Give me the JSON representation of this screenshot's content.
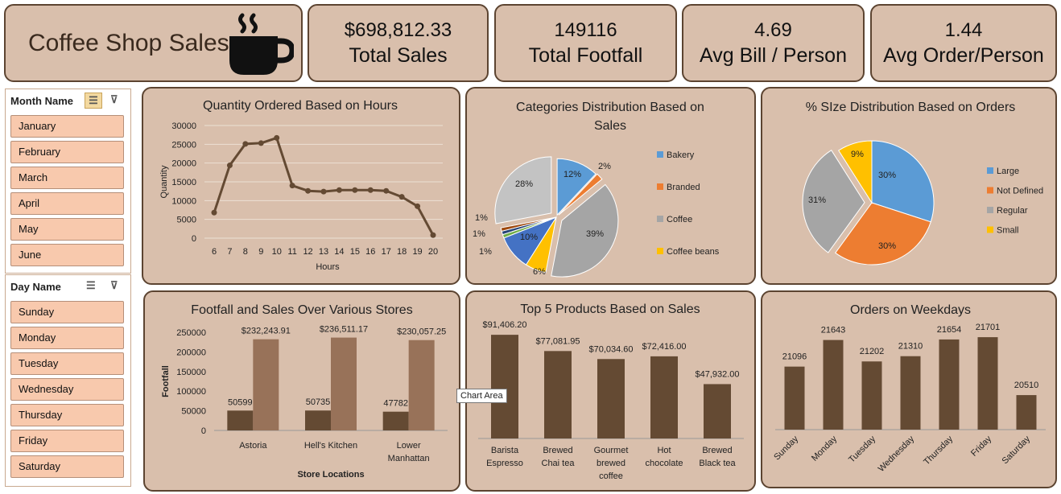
{
  "header": {
    "title": "Coffee Shop Sales",
    "icon": "coffee-cup-icon"
  },
  "kpis": [
    {
      "value": "$698,812.33",
      "label": "Total Sales"
    },
    {
      "value": "149116",
      "label": "Total Footfall"
    },
    {
      "value": "4.69",
      "label": "Avg Bill / Person"
    },
    {
      "value": "1.44",
      "label": "Avg Order/Person"
    }
  ],
  "slicers": {
    "month": {
      "title": "Month Name",
      "items": [
        "January",
        "February",
        "March",
        "April",
        "May",
        "June"
      ]
    },
    "day": {
      "title": "Day Name",
      "items": [
        "Sunday",
        "Monday",
        "Tuesday",
        "Wednesday",
        "Thursday",
        "Friday",
        "Saturday"
      ]
    }
  },
  "tooltip": "Chart Area",
  "colors": {
    "card": "#d9bfac",
    "border": "#5c4431",
    "bar_dark": "#644a33",
    "bar_light": "#987259",
    "slicer_item": "#f8c9ad"
  },
  "chart_data": [
    {
      "type": "line",
      "title": "Quantity Ordered Based on Hours",
      "xlabel": "Hours",
      "ylabel": "Quantity",
      "x": [
        6,
        7,
        8,
        9,
        10,
        11,
        12,
        13,
        14,
        15,
        16,
        17,
        18,
        19,
        20
      ],
      "values": [
        6800,
        19400,
        25100,
        25300,
        26700,
        14000,
        12600,
        12400,
        12800,
        12800,
        12800,
        12600,
        11000,
        8500,
        800
      ],
      "yticks": [
        0,
        5000,
        10000,
        15000,
        20000,
        25000,
        30000
      ],
      "ylim": [
        0,
        30000
      ],
      "grid": true
    },
    {
      "type": "pie",
      "title": "Categories Distribution Based on Sales",
      "slices": [
        {
          "name": "Bakery",
          "value": 12,
          "label": "12%",
          "color": "#5b9bd5"
        },
        {
          "name": "Branded",
          "value": 2,
          "label": "2%",
          "color": "#ed7d31"
        },
        {
          "name": "Coffee",
          "value": 39,
          "label": "39%",
          "color": "#a5a5a5"
        },
        {
          "name": "Coffee beans",
          "value": 6,
          "label": "6%",
          "color": "#ffc000"
        },
        {
          "name": "",
          "value": 10,
          "label": "10%",
          "color": "#4472c4"
        },
        {
          "name": "",
          "value": 1,
          "label": "1%",
          "color": "#70ad47"
        },
        {
          "name": "",
          "value": 1,
          "label": "1%",
          "color": "#264478"
        },
        {
          "name": "",
          "value": 1,
          "label": "1%",
          "color": "#9e480e"
        },
        {
          "name": "",
          "value": 28,
          "label": "28%",
          "color": "#c3c3c3"
        }
      ],
      "legend": [
        "Bakery",
        "Branded",
        "Coffee",
        "Coffee beans"
      ],
      "legend_placement": "right"
    },
    {
      "type": "pie",
      "title": "% SIze Distribution Based on Orders",
      "slices": [
        {
          "name": "Large",
          "value": 30,
          "label": "30%",
          "color": "#5b9bd5"
        },
        {
          "name": "Not Defined",
          "value": 30,
          "label": "30%",
          "color": "#ed7d31"
        },
        {
          "name": "Regular",
          "value": 31,
          "label": "31%",
          "color": "#a5a5a5"
        },
        {
          "name": "Small",
          "value": 9,
          "label": "9%",
          "color": "#ffc000"
        }
      ],
      "legend": [
        "Large",
        "Not Defined",
        "Regular",
        "Small"
      ],
      "legend_placement": "right"
    },
    {
      "type": "bar",
      "title": "Footfall and Sales Over Various Stores",
      "xlabel": "Store Locations",
      "ylabel": "Footfall",
      "categories": [
        [
          "Astoria"
        ],
        [
          "Hell's Kitchen"
        ],
        [
          "Lower",
          "Manhattan"
        ]
      ],
      "series": [
        {
          "values": [
            50599,
            50735,
            47782
          ],
          "labels": [
            "50599",
            "50735",
            "47782"
          ]
        },
        {
          "values": [
            232243.91,
            236511.17,
            230057.25
          ],
          "labels": [
            "$232,243.91",
            "$236,511.17",
            "$230,057.25"
          ]
        }
      ],
      "yticks": [
        0,
        50000,
        100000,
        150000,
        200000,
        250000
      ],
      "ylim": [
        0,
        250000
      ]
    },
    {
      "type": "bar",
      "title": "Top 5 Products Based on Sales",
      "categories": [
        [
          "Barista",
          "Espresso"
        ],
        [
          "Brewed",
          "Chai tea"
        ],
        [
          "Gourmet",
          "brewed",
          "coffee"
        ],
        [
          "Hot",
          "chocolate"
        ],
        [
          "Brewed",
          "Black tea"
        ]
      ],
      "values": [
        91406.2,
        77081.95,
        70034.6,
        72416.0,
        47932.0
      ],
      "labels": [
        "$91,406.20",
        "$77,081.95",
        "$70,034.60",
        "$72,416.00",
        "$47,932.00"
      ],
      "ylim": [
        0,
        100000
      ]
    },
    {
      "type": "bar",
      "title": "Orders on Weekdays",
      "categories": [
        "Sunday",
        "Monday",
        "Tuesday",
        "Wednesday",
        "Thursday",
        "Friday",
        "Saturday"
      ],
      "values": [
        21096,
        21643,
        21202,
        21310,
        21654,
        21701,
        20510
      ],
      "labels": [
        "21096",
        "21643",
        "21202",
        "21310",
        "21654",
        "21701",
        "20510"
      ],
      "ylim": [
        19800,
        22000
      ]
    }
  ]
}
